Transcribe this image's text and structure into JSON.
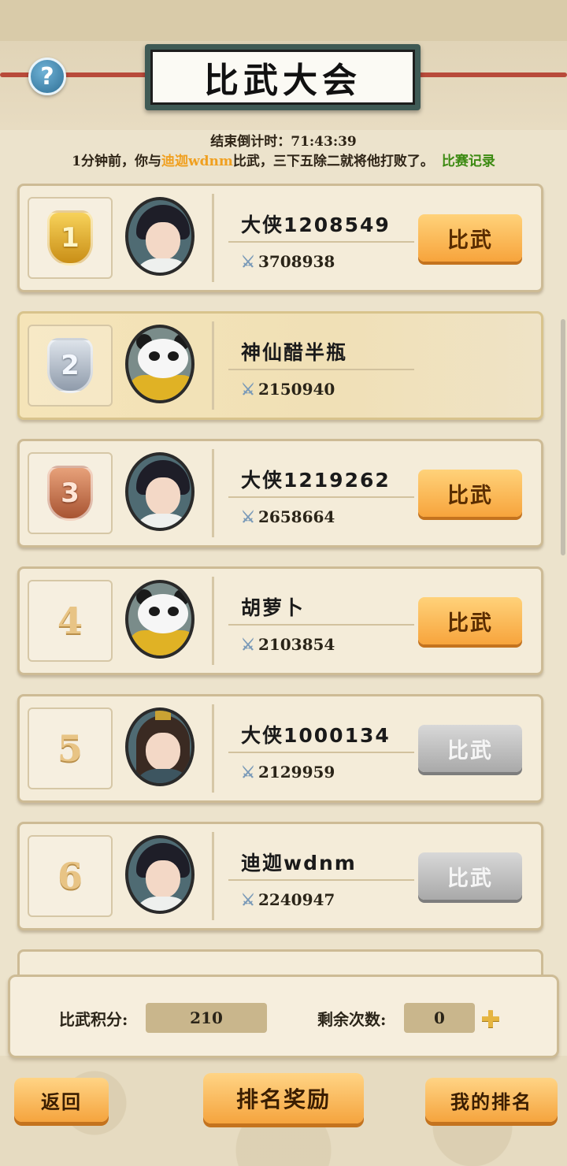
{
  "header": {
    "title": "比武大会",
    "help_label": "?",
    "countdown": "结束倒计时：71:43:39"
  },
  "notice": {
    "prefix": "1分钟前，你与",
    "opponent": "迪迦wdnm",
    "suffix": "比武，三下五除二就将他打败了。",
    "record_link": "比赛记录"
  },
  "players": [
    {
      "rank": "1",
      "name": "大侠1208549",
      "power": "3708938",
      "button": "比武",
      "button_enabled": true,
      "avatar": "swordsman"
    },
    {
      "rank": "2",
      "name": "神仙醋半瓶",
      "power": "2150940",
      "button": "",
      "button_enabled": false,
      "avatar": "panda"
    },
    {
      "rank": "3",
      "name": "大侠1219262",
      "power": "2658664",
      "button": "比武",
      "button_enabled": true,
      "avatar": "swordsman"
    },
    {
      "rank": "4",
      "name": "胡萝卜",
      "power": "2103854",
      "button": "比武",
      "button_enabled": true,
      "avatar": "panda"
    },
    {
      "rank": "5",
      "name": "大侠1000134",
      "power": "2129959",
      "button": "比武",
      "button_enabled": false,
      "avatar": "long-hair"
    },
    {
      "rank": "6",
      "name": "迪迦wdnm",
      "power": "2240947",
      "button": "比武",
      "button_enabled": false,
      "avatar": "swordsman"
    }
  ],
  "stats": {
    "score_label": "比武积分:",
    "score_value": "210",
    "remaining_label": "剩余次数:",
    "remaining_value": "0"
  },
  "bottom": {
    "back": "返回",
    "reward": "排名奖励",
    "my_rank": "我的排名"
  },
  "colors": {
    "accent_orange": "#f7a43c",
    "opponent_highlight": "#f0a020",
    "record_link": "#3c8a12",
    "disabled_gray": "#a9a9a9"
  }
}
